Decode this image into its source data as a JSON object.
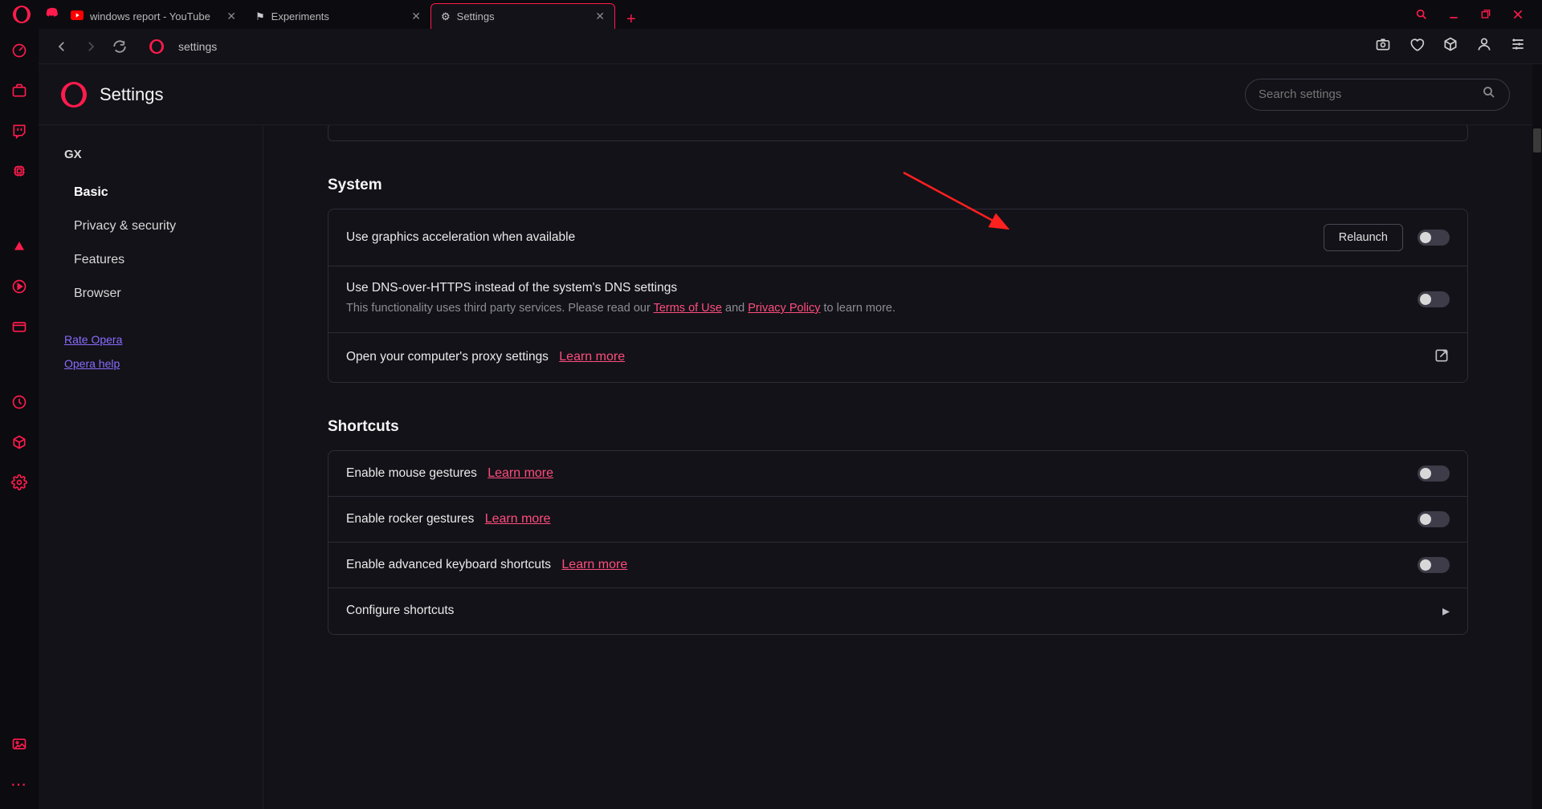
{
  "tabs": [
    {
      "label": "windows report - YouTube",
      "icon": "youtube"
    },
    {
      "label": "Experiments",
      "icon": "flag"
    },
    {
      "label": "Settings",
      "icon": "gear"
    }
  ],
  "address": "settings",
  "page_title": "Settings",
  "search": {
    "placeholder": "Search settings"
  },
  "sidebar": {
    "category": "GX",
    "items": [
      "Basic",
      "Privacy & security",
      "Features",
      "Browser"
    ],
    "active_index": 0,
    "links": [
      "Rate Opera",
      "Opera help"
    ]
  },
  "sections": {
    "system": {
      "heading": "System",
      "rows": {
        "gpu": {
          "label": "Use graphics acceleration when available",
          "action": "Relaunch"
        },
        "dns": {
          "label": "Use DNS-over-HTTPS instead of the system's DNS settings",
          "desc_pre": "This functionality uses third party services. Please read our ",
          "tos": "Terms of Use",
          "and": " and ",
          "privacy": "Privacy Policy",
          "desc_post": " to learn more."
        },
        "proxy": {
          "label": "Open your computer's proxy settings",
          "link": "Learn more"
        }
      }
    },
    "shortcuts": {
      "heading": "Shortcuts",
      "rows": {
        "mouse": {
          "label": "Enable mouse gestures",
          "link": "Learn more"
        },
        "rocker": {
          "label": "Enable rocker gestures",
          "link": "Learn more"
        },
        "kbd": {
          "label": "Enable advanced keyboard shortcuts",
          "link": "Learn more"
        },
        "configure": {
          "label": "Configure shortcuts"
        }
      }
    }
  }
}
